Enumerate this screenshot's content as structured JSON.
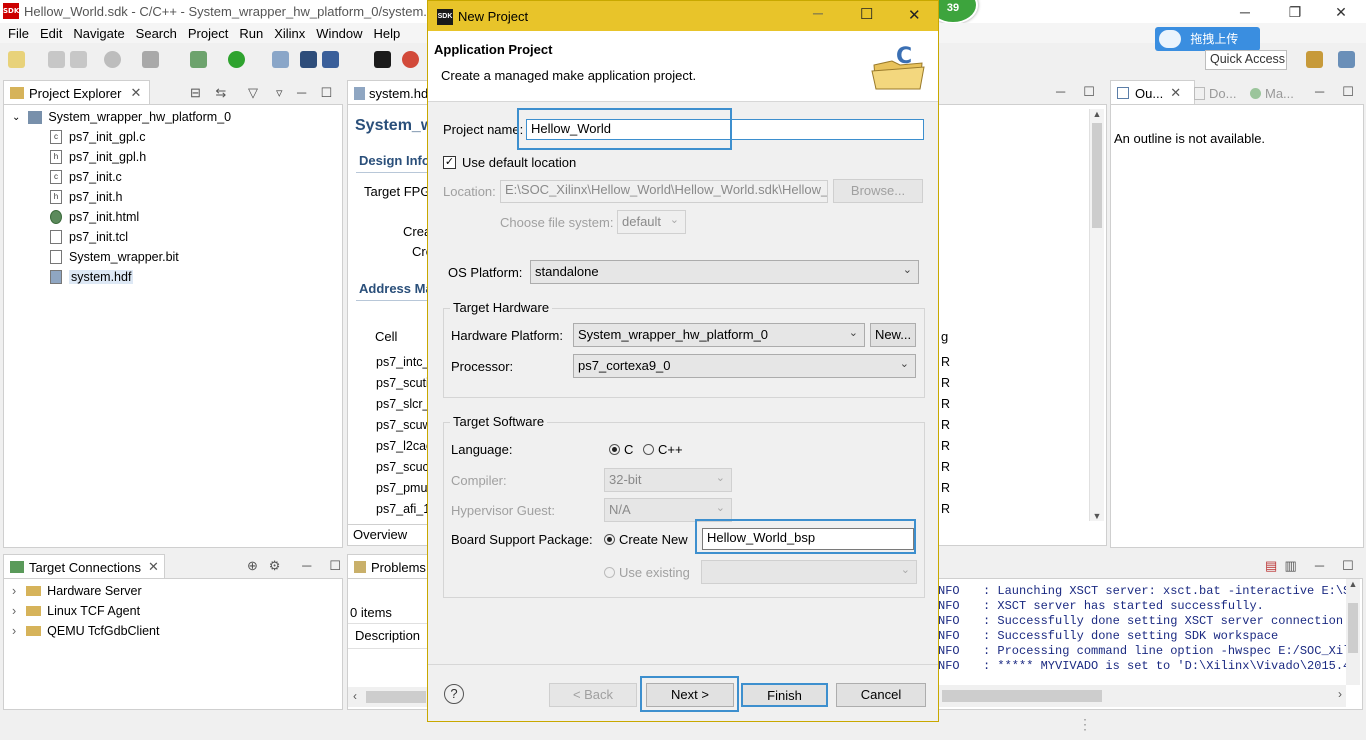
{
  "window": {
    "title": "Hellow_World.sdk - C/C++ - System_wrapper_hw_platform_0/system.h",
    "app_badge": "SDK"
  },
  "menu": [
    "File",
    "Edit",
    "Navigate",
    "Search",
    "Project",
    "Run",
    "Xilinx",
    "Window",
    "Help"
  ],
  "badge_number": "39",
  "upload_button": "拖拽上传",
  "quick_access": "Quick Access",
  "project_explorer": {
    "tab": "Project Explorer",
    "root": "System_wrapper_hw_platform_0",
    "files": [
      "ps7_init_gpl.c",
      "ps7_init_gpl.h",
      "ps7_init.c",
      "ps7_init.h",
      "ps7_init.html",
      "ps7_init.tcl",
      "System_wrapper.bit",
      "system.hdf"
    ],
    "selected": "system.hdf"
  },
  "editor": {
    "tab": "system.hd",
    "heading": "System_w",
    "design_info": "Design Info",
    "target_fpga": "Target FPG",
    "crea1": "Crea",
    "crea2": "Cre",
    "address_map": "Address Ma",
    "cell_header": "Cell",
    "cells": [
      "ps7_intc_",
      "ps7_scuti",
      "ps7_slcr_",
      "ps7_scuw",
      "ps7_l2cac",
      "ps7_scuc",
      "ps7_pmu",
      "ps7_afi_1"
    ],
    "right_col_header": "g",
    "right_col_values": [
      "R",
      "R",
      "R",
      "R",
      "R",
      "R",
      "R",
      "R"
    ],
    "bottom_tab": "Overview"
  },
  "outline": {
    "tabs": [
      "Ou...",
      "Do...",
      "Ma..."
    ],
    "message": "An outline is not available."
  },
  "target_connections": {
    "tab": "Target Connections",
    "items": [
      "Hardware Server",
      "Linux TCF Agent",
      "QEMU TcfGdbClient"
    ]
  },
  "problems": {
    "tab": "Problems",
    "count": "0 items",
    "column": "Description"
  },
  "console": {
    "lines": [
      {
        "level": "NFO",
        "text": ": Launching XSCT server: xsct.bat -interactive E:\\SO"
      },
      {
        "level": "NFO",
        "text": ": XSCT server has started successfully."
      },
      {
        "level": "NFO",
        "text": ": Successfully done setting XSCT server connection c"
      },
      {
        "level": "NFO",
        "text": ": Successfully done setting SDK workspace"
      },
      {
        "level": "NFO",
        "text": ": Processing command line option -hwspec E:/SOC_Xil"
      },
      {
        "level": "NFO",
        "text": ": ***** MYVIVADO is set to 'D:\\Xilinx\\Vivado\\2015.4'"
      }
    ]
  },
  "dialog": {
    "title": "New Project",
    "header_title": "Application Project",
    "header_subtitle": "Create a managed make application project.",
    "project_name_label": "Project name:",
    "project_name_value": "Hellow_World",
    "use_default_location": "Use default location",
    "location_label": "Location:",
    "location_value": "E:\\SOC_Xilinx\\Hellow_World\\Hellow_World.sdk\\Hellow_W",
    "browse_button": "Browse...",
    "file_system_label": "Choose file system:",
    "file_system_value": "default",
    "os_platform_label": "OS Platform:",
    "os_platform_value": "standalone",
    "target_hardware_group": "Target Hardware",
    "hardware_platform_label": "Hardware Platform:",
    "hardware_platform_value": "System_wrapper_hw_platform_0",
    "new_button": "New...",
    "processor_label": "Processor:",
    "processor_value": "ps7_cortexa9_0",
    "target_software_group": "Target Software",
    "language_label": "Language:",
    "lang_c": "C",
    "lang_cpp": "C++",
    "compiler_label": "Compiler:",
    "compiler_value": "32-bit",
    "hypervisor_label": "Hypervisor Guest:",
    "hypervisor_value": "N/A",
    "bsp_label": "Board Support Package:",
    "create_new": "Create New",
    "bsp_value": "Hellow_World_bsp",
    "use_existing": "Use existing",
    "back_button": "< Back",
    "next_button": "Next >",
    "finish_button": "Finish",
    "cancel_button": "Cancel",
    "help_symbol": "?"
  }
}
